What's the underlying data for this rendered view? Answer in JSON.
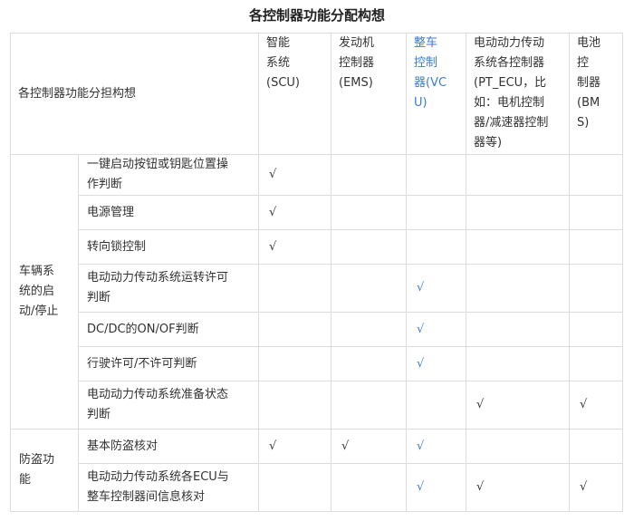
{
  "title": "各控制器功能分配构想",
  "header": {
    "corner": "各控制器功能分担构想",
    "columns": [
      "智能系统(SCU)",
      "发动机控制器(EMS)",
      "整车控制器(VCU)",
      "电动动力传动系统各控制器(PT_ECU，比如：电机控制器/减速器控制器等)",
      "电池控制器(BMS)"
    ]
  },
  "groups": [
    {
      "name": "车辆系统的启动/停止",
      "rows": [
        {
          "label": "一键启动按钮或钥匙位置操作判断",
          "marks": [
            "√",
            "",
            "",
            "",
            ""
          ]
        },
        {
          "label": "电源管理",
          "marks": [
            "√",
            "",
            "",
            "",
            ""
          ]
        },
        {
          "label": "转向锁控制",
          "marks": [
            "√",
            "",
            "",
            "",
            ""
          ]
        },
        {
          "label": "电动动力传动系统运转许可判断",
          "marks": [
            "",
            "",
            "√",
            "",
            ""
          ]
        },
        {
          "label": "DC/DC的ON/OF判断",
          "marks": [
            "",
            "",
            "√",
            "",
            ""
          ]
        },
        {
          "label": "行驶许可/不许可判断",
          "marks": [
            "",
            "",
            "√",
            "",
            ""
          ]
        },
        {
          "label": "电动动力传动系统准备状态判断",
          "marks": [
            "",
            "",
            "",
            "√",
            "√"
          ]
        }
      ]
    },
    {
      "name": "防盗功能",
      "rows": [
        {
          "label": "基本防盗核对",
          "marks": [
            "√",
            "√",
            "√",
            "",
            ""
          ]
        },
        {
          "label": "电动动力传动系统各ECU与整车控制器间信息核对",
          "marks": [
            "",
            "",
            "√",
            "√",
            "√"
          ]
        }
      ]
    }
  ],
  "colors": {
    "highlight": "#3a7bd5",
    "border": "#dcdcdc",
    "text": "#333333"
  }
}
